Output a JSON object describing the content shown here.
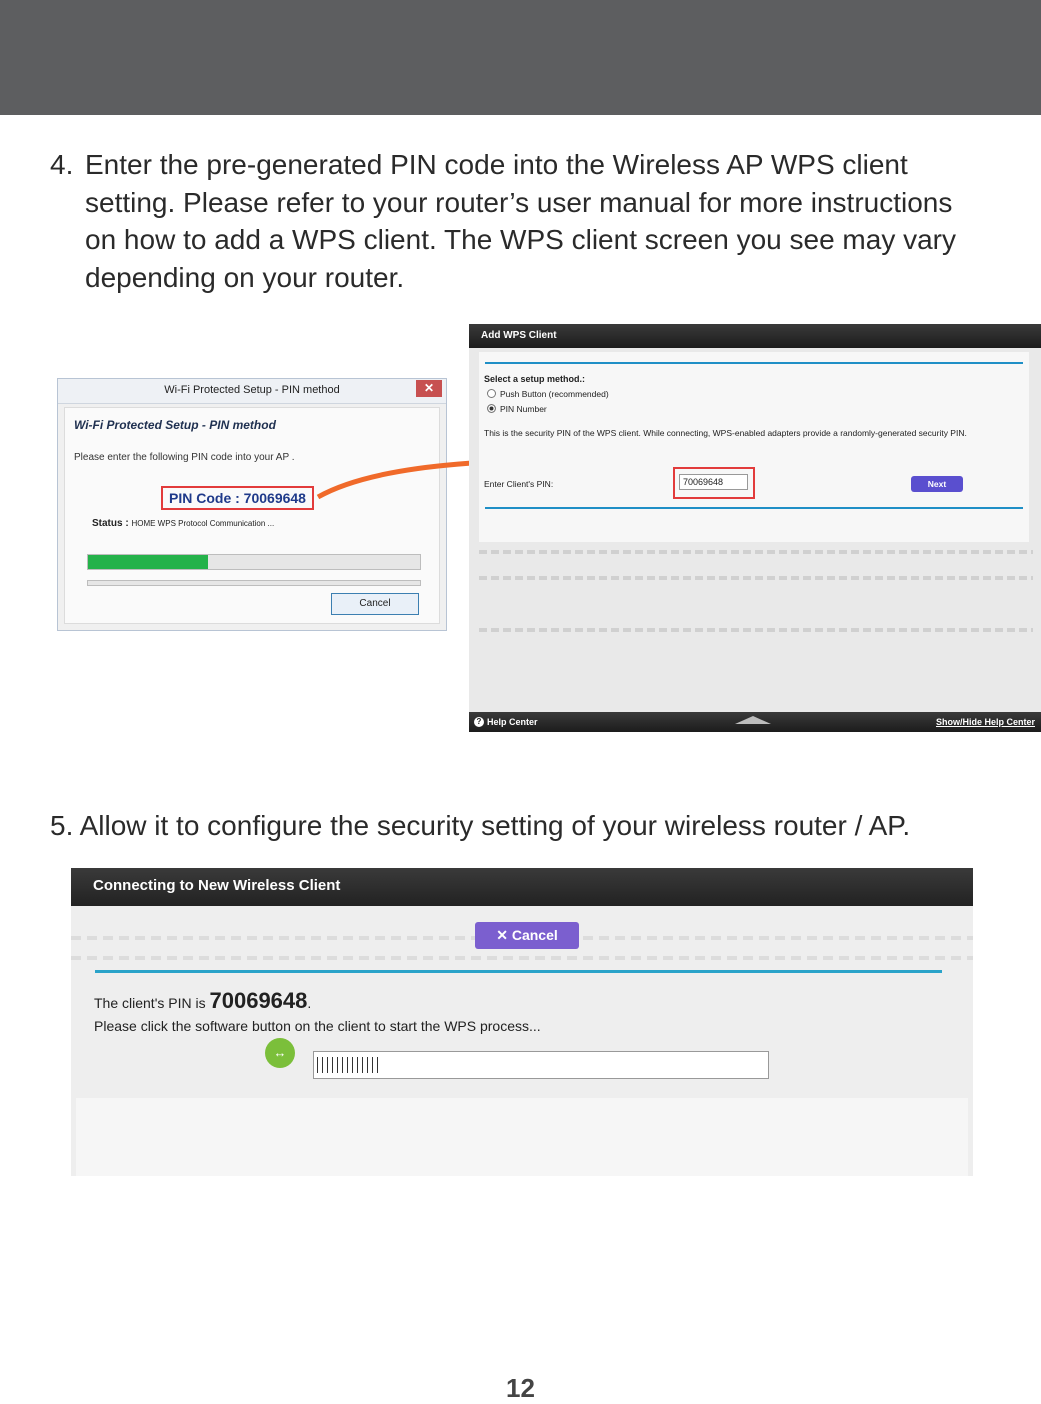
{
  "step4": {
    "number": "4.",
    "lines": [
      "Enter the pre-generated PIN code into the Wireless AP WPS client",
      "setting. Please refer to your router’s user manual for more instructions",
      "on how to add a WPS client. The WPS client screen you see may vary",
      "depending on your router."
    ]
  },
  "win_dialog": {
    "title": "Wi-Fi Protected Setup - PIN method",
    "close": "✕",
    "heading": "Wi-Fi Protected Setup - PIN method",
    "prompt": "Please enter the following PIN code into your AP .",
    "pin": "PIN Code :  70069648",
    "status_label": "Status :",
    "status_value": "HOME WPS Protocol Communication ...",
    "progress": 0.36,
    "cancel": "Cancel"
  },
  "netgear": {
    "header": "Add WPS Client",
    "select_label": "Select a setup method.:",
    "option_push": "Push Button (recommended)",
    "option_pin": "PIN Number",
    "desc": "This is the security PIN of the WPS client. While connecting, WPS-enabled adapters provide a randomly-generated security PIN.",
    "pin_label": "Enter Client's PIN:",
    "pin_value": "70069648",
    "next": "Next",
    "help_icon": "?",
    "help": "Help Center",
    "showhide": "Show/Hide Help Center"
  },
  "step5": {
    "text": "5. Allow it to configure the security setting of your wireless router / AP."
  },
  "connecting": {
    "header": "Connecting to New Wireless Client",
    "cancel": "✕ Cancel",
    "pin_prefix": "The client's PIN is ",
    "pin": "70069648",
    "pin_suffix": ".",
    "instruction": "Please click the software button on the client to start the WPS process...",
    "wps_icon": "↔"
  },
  "page_number": "12",
  "colors": {
    "top_bar": "#5d5e60",
    "highlight": "#e23b3b",
    "accent_rule": "#1f8fc6",
    "button": "#5a4fcf",
    "progress": "#24b24a",
    "arrow": "#f06a2a"
  }
}
